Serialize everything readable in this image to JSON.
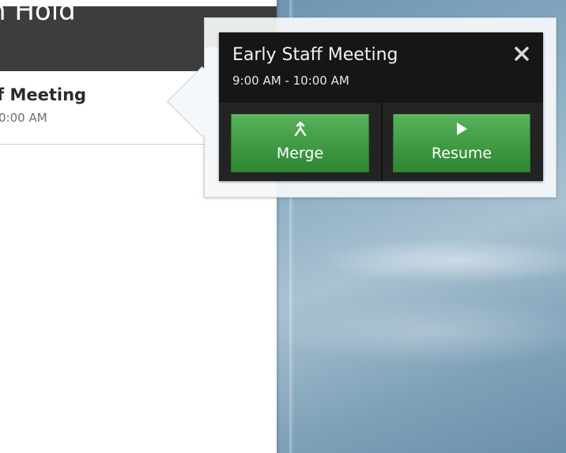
{
  "panel": {
    "header_title": "n Hold",
    "item": {
      "title": "f Meeting",
      "time": "0:00 AM"
    }
  },
  "popover": {
    "title": "Early Staff Meeting",
    "time": "9:00 AM - 10:00 AM",
    "close_icon": "close-icon",
    "actions": {
      "merge_label": "Merge",
      "merge_icon": "merge-icon",
      "resume_label": "Resume",
      "resume_icon": "play-icon"
    }
  },
  "colors": {
    "header_bg": "#3d3d3d",
    "popover_bg": "#161616",
    "button_green": "#3f9a43",
    "desktop_blue": "#8fb0c5"
  }
}
